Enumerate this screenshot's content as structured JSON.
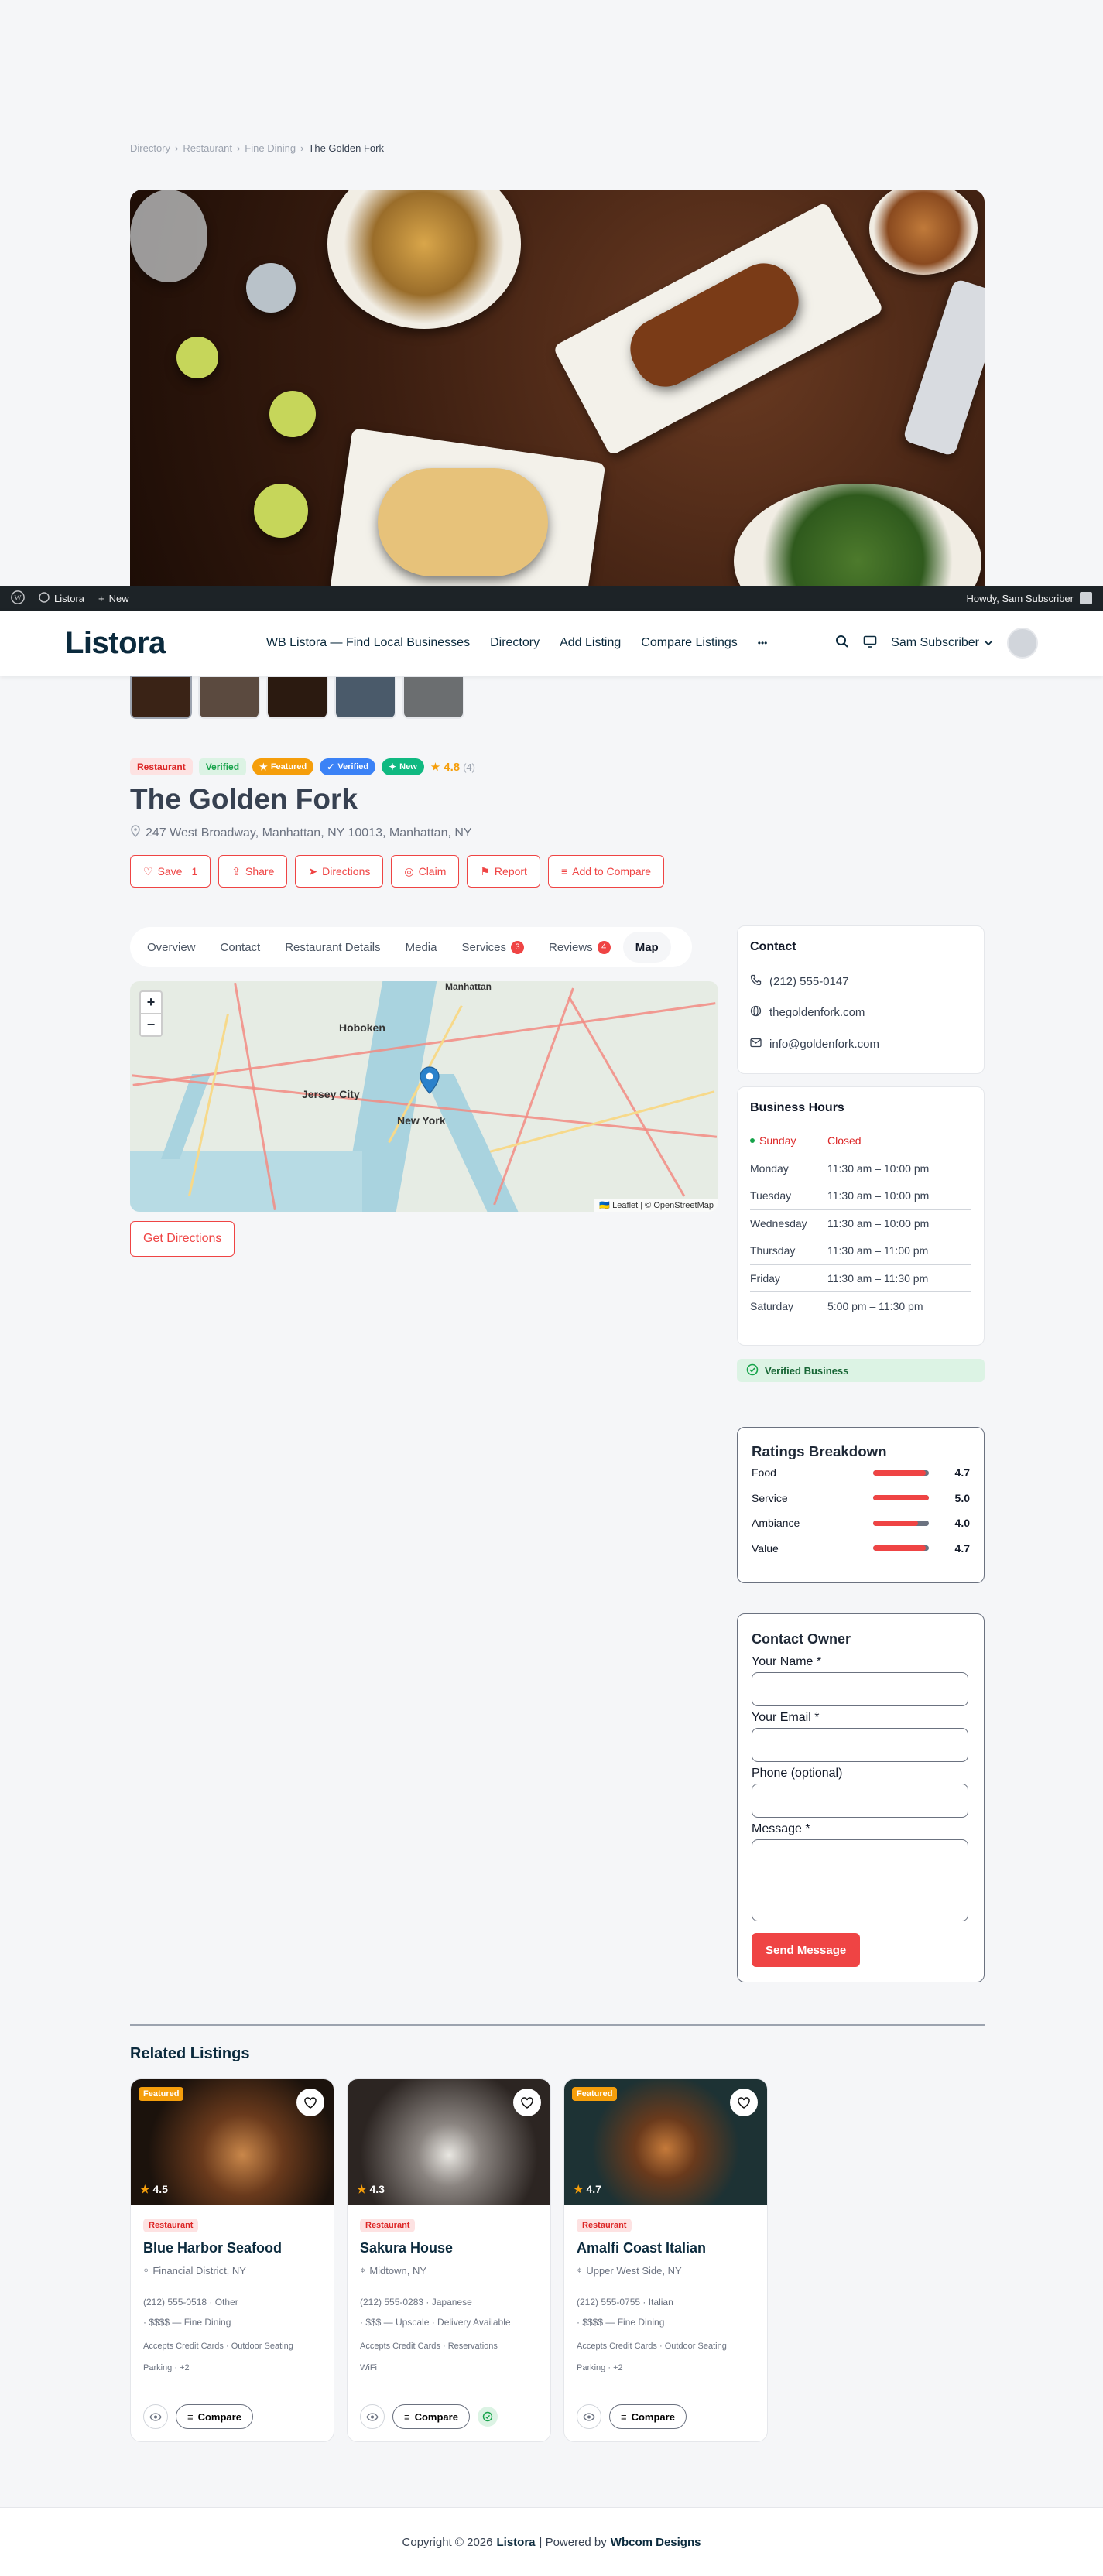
{
  "breadcrumb": {
    "items": [
      "Directory",
      "Restaurant",
      "Fine Dining"
    ],
    "current": "The Golden Fork"
  },
  "adminbar": {
    "site": "Listora",
    "new": "New",
    "howdy": "Howdy, Sam Subscriber"
  },
  "header": {
    "logo": "Listora",
    "nav": [
      "WB Listora — Find Local Businesses",
      "Directory",
      "Add Listing",
      "Compare Listings",
      "•••"
    ],
    "user": "Sam Subscriber"
  },
  "listing": {
    "badges": [
      "Restaurant",
      "Verified",
      "Featured",
      "Verified",
      "New"
    ],
    "rating": "4.8",
    "rating_count": "(4)",
    "title": "The Golden Fork",
    "address": "247 West Broadway, Manhattan, NY 10013, Manhattan, NY",
    "actions": {
      "save": "Save",
      "save_count": "1",
      "share": "Share",
      "directions": "Directions",
      "claim": "Claim",
      "report": "Report",
      "compare": "Add to Compare"
    }
  },
  "tabs": [
    {
      "label": "Overview"
    },
    {
      "label": "Contact"
    },
    {
      "label": "Restaurant Details"
    },
    {
      "label": "Media"
    },
    {
      "label": "Services",
      "count": "3"
    },
    {
      "label": "Reviews",
      "count": "4"
    },
    {
      "label": "Map"
    }
  ],
  "map": {
    "labels": {
      "hoboken": "Hoboken",
      "jersey": "Jersey City",
      "newyork": "New York",
      "manhattan": "Manhattan"
    },
    "zoom_in": "+",
    "zoom_out": "−",
    "attribution": "🇺🇦 Leaflet | © OpenStreetMap"
  },
  "get_directions": "Get Directions",
  "contact": {
    "title": "Contact",
    "phone": "(212) 555-0147",
    "website": "thegoldenfork.com",
    "email": "info@goldenfork.com"
  },
  "hours": {
    "title": "Business Hours",
    "rows": [
      {
        "day": "Sunday",
        "time": "Closed"
      },
      {
        "day": "Monday",
        "time": "11:30 am – 10:00 pm"
      },
      {
        "day": "Tuesday",
        "time": "11:30 am – 10:00 pm"
      },
      {
        "day": "Wednesday",
        "time": "11:30 am – 10:00 pm"
      },
      {
        "day": "Thursday",
        "time": "11:30 am – 11:00 pm"
      },
      {
        "day": "Friday",
        "time": "11:30 am – 11:30 pm"
      },
      {
        "day": "Saturday",
        "time": "5:00 pm – 11:30 pm"
      }
    ]
  },
  "verified_business": "Verified Business",
  "ratings": {
    "title": "Ratings Breakdown",
    "rows": [
      {
        "name": "Food",
        "value": "4.7",
        "fraction": 0.94
      },
      {
        "name": "Service",
        "value": "5.0",
        "fraction": 1.0
      },
      {
        "name": "Ambiance",
        "value": "4.0",
        "fraction": 0.8
      },
      {
        "name": "Value",
        "value": "4.7",
        "fraction": 0.94
      }
    ]
  },
  "owner_form": {
    "title": "Contact Owner",
    "name": "Your Name *",
    "email": "Your Email *",
    "phone": "Phone (optional)",
    "message": "Message *",
    "send": "Send Message"
  },
  "related": {
    "title": "Related Listings",
    "items": [
      {
        "featured": "Featured",
        "rating": "4.5",
        "tag": "Restaurant",
        "name": "Blue Harbor Seafood",
        "location": "Financial District, NY",
        "meta1": "(212) 555-0518 · Other",
        "meta2": "· $$$$ — Fine Dining",
        "amen1": "Accepts Credit Cards · Outdoor Seating",
        "amen2": "Parking · +2",
        "compare": "Compare"
      },
      {
        "featured": "",
        "rating": "4.3",
        "tag": "Restaurant",
        "name": "Sakura House",
        "location": "Midtown, NY",
        "meta1": "(212) 555-0283 · Japanese",
        "meta2": "· $$$ — Upscale · Delivery Available",
        "amen1": "Accepts Credit Cards · Reservations",
        "amen2": "WiFi",
        "compare": "Compare"
      },
      {
        "featured": "Featured",
        "rating": "4.7",
        "tag": "Restaurant",
        "name": "Amalfi Coast Italian",
        "location": "Upper West Side, NY",
        "meta1": "(212) 555-0755 · Italian",
        "meta2": "· $$$$ — Fine Dining",
        "amen1": "Accepts Credit Cards · Outdoor Seating",
        "amen2": "Parking · +2",
        "compare": "Compare"
      }
    ]
  },
  "footer": {
    "copy": "Copyright © 2026",
    "site": "Listora",
    "sep": "| Powered by",
    "by": "Wbcom Designs"
  },
  "colors": {
    "accent": "#ef4444",
    "brand": "#0b2a3d",
    "featured": "#f59e0b",
    "verified": "#3b82f6",
    "new": "#10b981"
  }
}
